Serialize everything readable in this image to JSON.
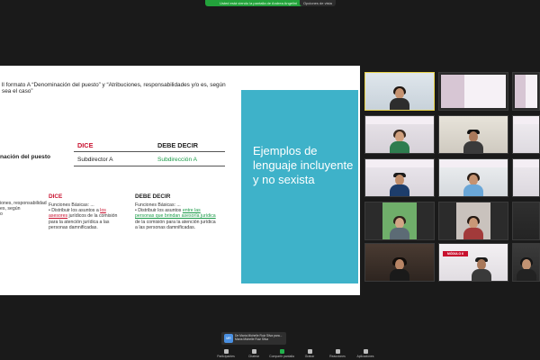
{
  "banner": {
    "sharing_text": "Usted está viendo la pantalla de Andrea Angelini",
    "view_options": "Opciones de vista"
  },
  "slide": {
    "top_text": "ll formato A “Denominación del puesto” y “Atribuciones, responsabilidades y/o es, según sea el caso”",
    "panel_title": "Ejemplos de lenguaje incluyente y no sexista",
    "table1": {
      "dice_label": "DICE",
      "debe_label": "DEBE DECIR",
      "row_label": "nación del puesto",
      "dice_value": "Subdirector A",
      "debe_value": "Subdirección A"
    },
    "table2": {
      "row_label_lines": [
        "iones, responsabilidad",
        "es, según",
        "o"
      ],
      "dice_label": "DICE",
      "debe_label": "DEBE DECIR",
      "dice_line1": "Funciones Básicas: ...",
      "dice_line2_pre": "• Distribuir los asuntos a ",
      "dice_line2_hl": "los",
      "dice_line3_hl": "asesores",
      "dice_line3_post": " jurídicos de la comisión",
      "dice_line4": "para la atención jurídica a las",
      "dice_line5": "personas damnificadas.",
      "debe_line1": "Funciones Básicas: ...",
      "debe_line2_pre": "• Distribuir los asuntos ",
      "debe_line2_hl": "entre las",
      "debe_line3_hl": "personas que brindan asesoría jurídica",
      "debe_line4": "de la comisión para la atención jurídica",
      "debe_line5": "a las personas damnificadas."
    }
  },
  "gallery": {
    "tile_label": "MÓDULO 6"
  },
  "notification": {
    "avatar": "MR",
    "text": "De María Michelle Ruiz Silva para... María Michelle Ruiz Silva"
  },
  "toolbar": {
    "items": [
      "Participantes",
      "Chatear",
      "Compartir pantalla",
      "Grabar",
      "Reacciones",
      "Aplicaciones"
    ]
  }
}
